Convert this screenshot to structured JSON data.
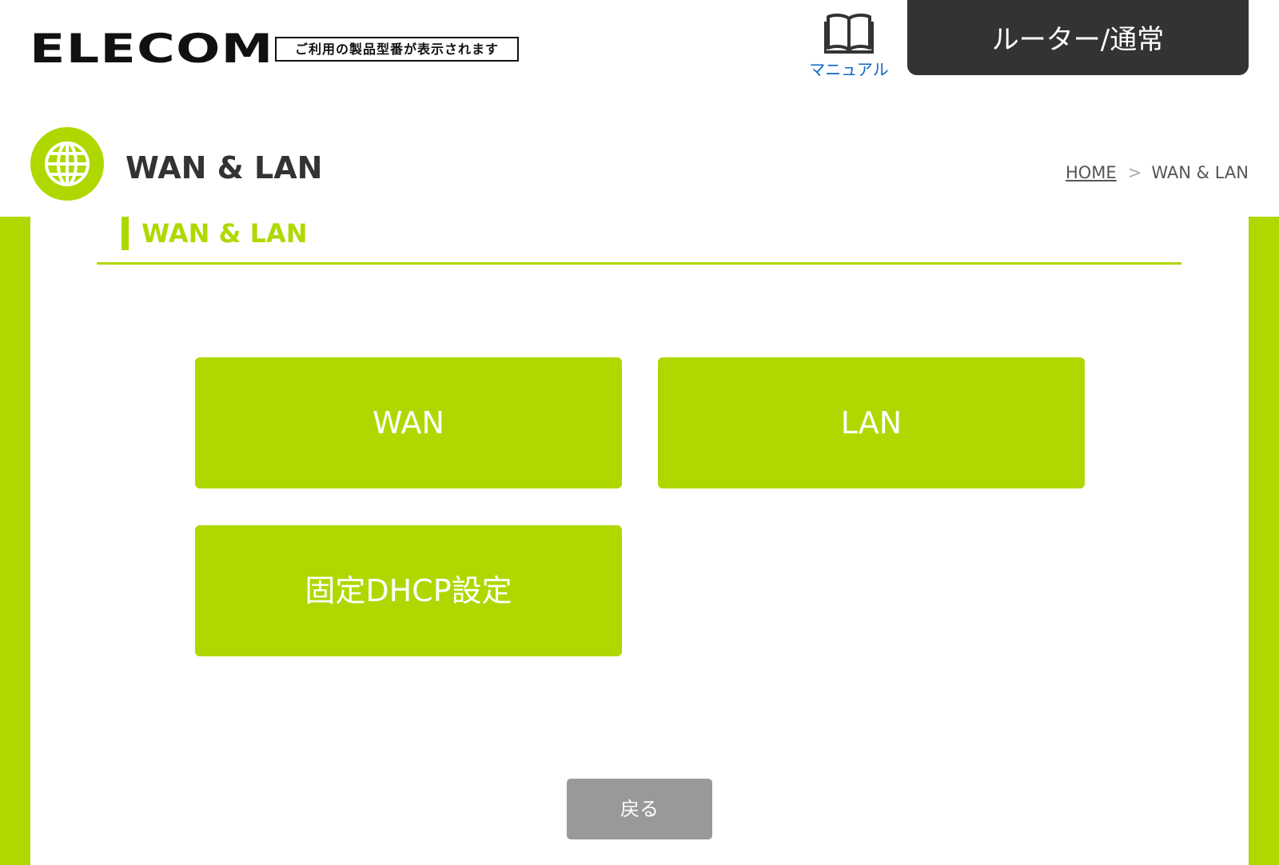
{
  "header": {
    "logo_text": "ELECOM",
    "model_placeholder": "ご利用の製品型番が表示されます",
    "manual_label": "マニュアル",
    "manual_icon": "book-icon",
    "mode_label": "ルーター/通常"
  },
  "page": {
    "icon": "globe-icon",
    "title": "WAN & LAN"
  },
  "breadcrumb": {
    "home": "HOME",
    "separator": ">",
    "current": "WAN & LAN"
  },
  "section": {
    "title": "WAN & LAN"
  },
  "menu": {
    "items": [
      {
        "label": "WAN"
      },
      {
        "label": "LAN"
      },
      {
        "label": "固定DHCP設定"
      }
    ]
  },
  "actions": {
    "back_label": "戻る"
  },
  "colors": {
    "accent": "#afd800",
    "dark": "#333333",
    "link": "#0a68c4",
    "back_button": "#999999"
  }
}
